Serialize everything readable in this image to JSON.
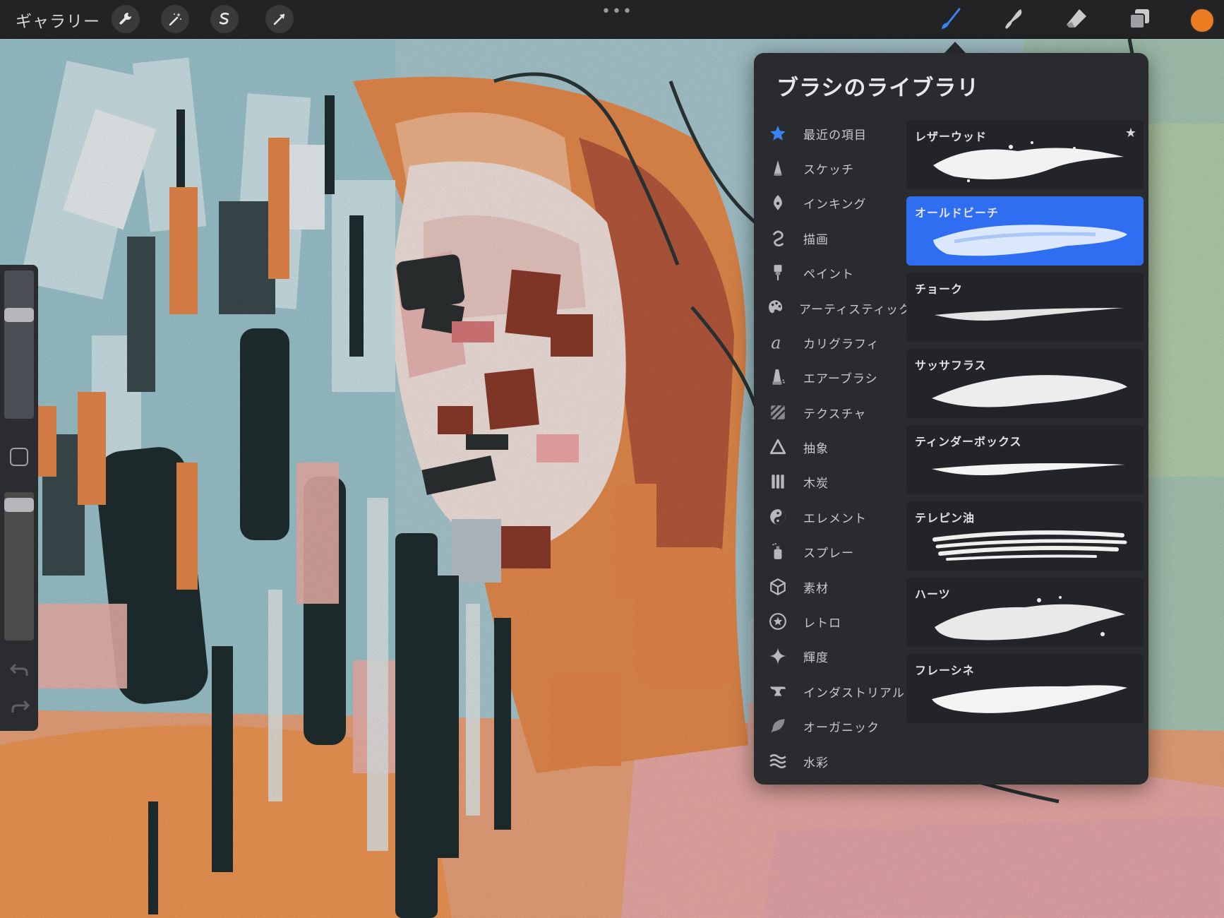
{
  "toolbar": {
    "gallery_label": "ギャラリー",
    "more_label": "•••",
    "left_tools": [
      "wrench-icon",
      "magic-wand-icon",
      "selection-s-icon",
      "transform-arrow-icon"
    ],
    "right_tools": [
      "brush-icon",
      "smudge-icon",
      "eraser-icon",
      "layers-icon"
    ],
    "active_tool": "brush-icon",
    "current_color": "#ec7c22"
  },
  "sidebar": {
    "brush_size_level": 0.72,
    "opacity_level": 0.96,
    "undo_icon": "undo-icon",
    "redo_icon": "redo-icon"
  },
  "library": {
    "title": "ブラシのライブラリ",
    "categories": [
      {
        "label": "最近の項目",
        "icon": "star-icon"
      },
      {
        "label": "スケッチ",
        "icon": "pencil-tip-icon"
      },
      {
        "label": "インキング",
        "icon": "pen-nib-icon"
      },
      {
        "label": "描画",
        "icon": "squiggle-icon"
      },
      {
        "label": "ペイント",
        "icon": "paint-brush-icon"
      },
      {
        "label": "アーティスティック",
        "icon": "palette-icon"
      },
      {
        "label": "カリグラフィ",
        "icon": "calligraphy-a-icon"
      },
      {
        "label": "エアーブラシ",
        "icon": "airbrush-icon"
      },
      {
        "label": "テクスチャ",
        "icon": "texture-icon"
      },
      {
        "label": "抽象",
        "icon": "triangle-icon"
      },
      {
        "label": "木炭",
        "icon": "charcoal-icon"
      },
      {
        "label": "エレメント",
        "icon": "yin-yang-icon"
      },
      {
        "label": "スプレー",
        "icon": "spray-can-icon"
      },
      {
        "label": "素材",
        "icon": "cube-icon"
      },
      {
        "label": "レトロ",
        "icon": "retro-star-icon"
      },
      {
        "label": "輝度",
        "icon": "sparkle-icon"
      },
      {
        "label": "インダストリアル",
        "icon": "anvil-icon"
      },
      {
        "label": "オーガニック",
        "icon": "leaf-icon"
      },
      {
        "label": "水彩",
        "icon": "waves-icon"
      }
    ],
    "active_category": "最近の項目",
    "brushes": [
      {
        "name": "レザーウッド",
        "starred": true
      },
      {
        "name": "オールドビーチ",
        "selected": true
      },
      {
        "name": "チョーク"
      },
      {
        "name": "サッサフラス"
      },
      {
        "name": "ティンダーボックス"
      },
      {
        "name": "テレピン油"
      },
      {
        "name": "ハーツ"
      },
      {
        "name": "フレーシネ"
      }
    ],
    "star_glyph": "★",
    "accent_color": "#2f6ef0"
  }
}
